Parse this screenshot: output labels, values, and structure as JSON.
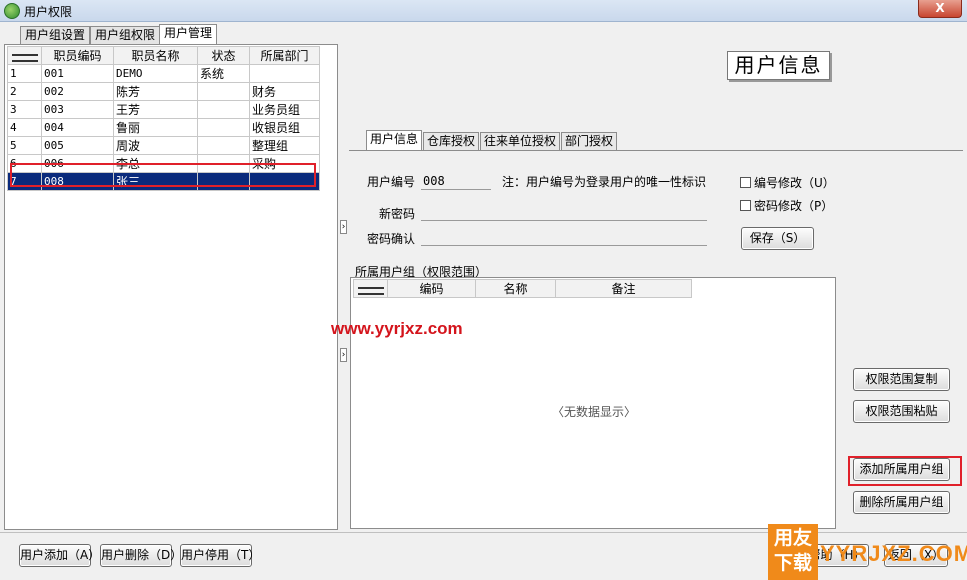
{
  "window": {
    "title": "用户权限",
    "close_label": "X"
  },
  "top_tabs": [
    "用户组设置",
    "用户组权限",
    "用户管理"
  ],
  "user_grid": {
    "columns": [
      "职员编码",
      "职员名称",
      "状态",
      "所属部门"
    ],
    "rows": [
      {
        "no": "1",
        "code": "001",
        "name": "DEMO",
        "status": "系统",
        "dept": ""
      },
      {
        "no": "2",
        "code": "002",
        "name": "陈芳",
        "status": "",
        "dept": "财务"
      },
      {
        "no": "3",
        "code": "003",
        "name": "王芳",
        "status": "",
        "dept": "业务员组"
      },
      {
        "no": "4",
        "code": "004",
        "name": "鲁丽",
        "status": "",
        "dept": "收银员组"
      },
      {
        "no": "5",
        "code": "005",
        "name": "周波",
        "status": "",
        "dept": "整理组"
      },
      {
        "no": "6",
        "code": "006",
        "name": "李总",
        "status": "",
        "dept": "采购"
      },
      {
        "no": "7",
        "code": "008",
        "name": "张三",
        "status": "",
        "dept": ""
      }
    ]
  },
  "heading": "用户信息",
  "sub_tabs": [
    "用户信息",
    "仓库授权",
    "往来单位授权",
    "部门授权"
  ],
  "user_info": {
    "user_no_label": "用户编号",
    "user_no_value": "008",
    "note": "注：用户编号为登录用户的唯一性标识",
    "new_password_label": "新密码",
    "confirm_password_label": "密码确认",
    "edit_no_label": "编号修改（U）",
    "edit_pwd_label": "密码修改（P）",
    "save_label": "保存（S）"
  },
  "groups": {
    "title": "所属用户组（权限范围）",
    "columns": [
      "编码",
      "名称",
      "备注"
    ],
    "empty_text": "〈无数据显示〉"
  },
  "side_buttons": {
    "copy": "权限范围复制",
    "paste": "权限范围粘贴",
    "add_group": "添加所属用户组",
    "delete_group": "删除所属用户组"
  },
  "bottom_buttons": {
    "add_user": "用户添加（A）",
    "delete_user": "用户删除（D）",
    "disable_user": "用户停用（T）",
    "help": "帮助（H）",
    "back": "返回（X）"
  },
  "watermark": "www.yyrjxz.com",
  "logo": {
    "line1": "用友",
    "line2": "下载",
    "brand": "YYRJXZ.COM"
  },
  "colors": {
    "selection": "#0a2a7c",
    "highlight": "#e0202a",
    "watermark": "#d4141c",
    "logo": "#f08a1a"
  }
}
